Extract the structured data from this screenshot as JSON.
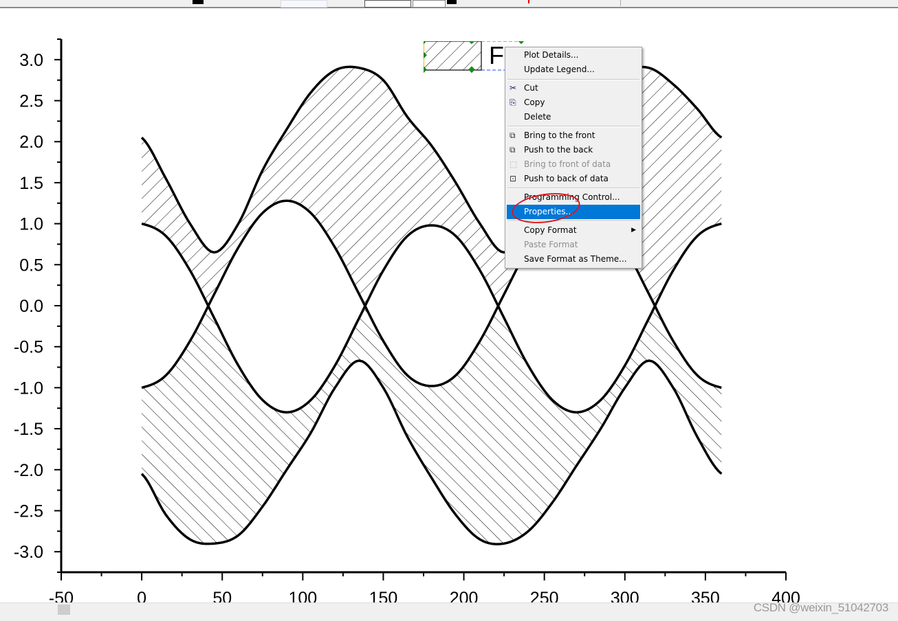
{
  "chart_data": {
    "type": "area",
    "xlim": [
      -50,
      400
    ],
    "ylim": [
      -3.25,
      3.25
    ],
    "x_ticks": [
      "-50",
      "0",
      "50",
      "100",
      "150",
      "200",
      "250",
      "300",
      "350",
      "400"
    ],
    "y_ticks": [
      "3.0",
      "2.5",
      "2.0",
      "1.5",
      "1.0",
      "0.5",
      "0.0",
      "-0.5",
      "-1.0",
      "-1.5",
      "-2.0",
      "-2.5",
      "-3.0"
    ],
    "grid": false,
    "x": [
      0,
      15,
      30,
      45,
      60,
      75,
      90,
      105,
      120,
      135,
      150,
      165,
      180,
      195,
      210,
      225,
      240,
      255,
      270,
      285,
      300,
      315,
      330,
      345,
      360
    ],
    "series": [
      {
        "values": [
          2.05,
          1.55,
          1.0,
          0.65,
          1.0,
          1.65,
          2.15,
          2.6,
          2.87,
          2.9,
          2.75,
          2.3,
          1.95,
          1.5,
          1.0,
          0.65,
          1.0,
          1.6,
          2.1,
          2.55,
          2.85,
          2.9,
          2.7,
          2.4,
          2.05
        ]
      },
      {
        "values": [
          1.0,
          0.85,
          0.43,
          -0.15,
          -0.73,
          -1.15,
          -1.3,
          -1.15,
          -0.73,
          -0.15,
          0.43,
          0.85,
          0.98,
          0.85,
          0.43,
          -0.15,
          -0.73,
          -1.15,
          -1.3,
          -1.15,
          -0.73,
          -0.15,
          0.43,
          0.85,
          1.0
        ]
      },
      {
        "values": [
          -1.0,
          -0.85,
          -0.43,
          0.14,
          0.71,
          1.13,
          1.28,
          1.13,
          0.71,
          0.14,
          -0.43,
          -0.85,
          -0.98,
          -0.85,
          -0.43,
          0.14,
          0.71,
          1.13,
          1.28,
          1.13,
          0.71,
          0.14,
          -0.43,
          -0.85,
          -1.0
        ]
      },
      {
        "values": [
          -2.05,
          -2.55,
          -2.85,
          -2.9,
          -2.8,
          -2.45,
          -2.0,
          -1.55,
          -1.0,
          -0.67,
          -1.0,
          -1.6,
          -2.1,
          -2.55,
          -2.85,
          -2.9,
          -2.75,
          -2.4,
          -1.95,
          -1.5,
          -1.0,
          -0.67,
          -1.0,
          -1.6,
          -2.05
        ]
      }
    ],
    "fill": "hatched region between outer curves and the inner curves"
  },
  "legend": {
    "text": "F"
  },
  "context_menu": {
    "items": [
      {
        "label": "Plot Details...",
        "icon": ""
      },
      {
        "label": "Update Legend...",
        "icon": ""
      },
      {
        "label": "Cut",
        "icon": "scissors-icon"
      },
      {
        "label": "Copy",
        "icon": "copy-icon"
      },
      {
        "label": "Delete",
        "icon": ""
      },
      {
        "label": "Bring to the front",
        "icon": "bring-front-icon"
      },
      {
        "label": "Push to the back",
        "icon": "push-back-icon"
      },
      {
        "label": "Bring to front of data",
        "icon": "bring-front-data-icon",
        "disabled": true
      },
      {
        "label": "Push to back of data",
        "icon": "push-back-data-icon"
      },
      {
        "label": "Programming Control...",
        "icon": ""
      },
      {
        "label": "Properties...",
        "icon": "",
        "highlighted": true
      },
      {
        "label": "Copy Format",
        "icon": "",
        "submenu": true
      },
      {
        "label": "Paste Format",
        "icon": "",
        "disabled": true
      },
      {
        "label": "Save Format as Theme...",
        "icon": ""
      }
    ],
    "highlight_color": "#0078d7",
    "annotation_color": "#e0151b"
  },
  "watermark": "CSDN @weixin_51042703"
}
